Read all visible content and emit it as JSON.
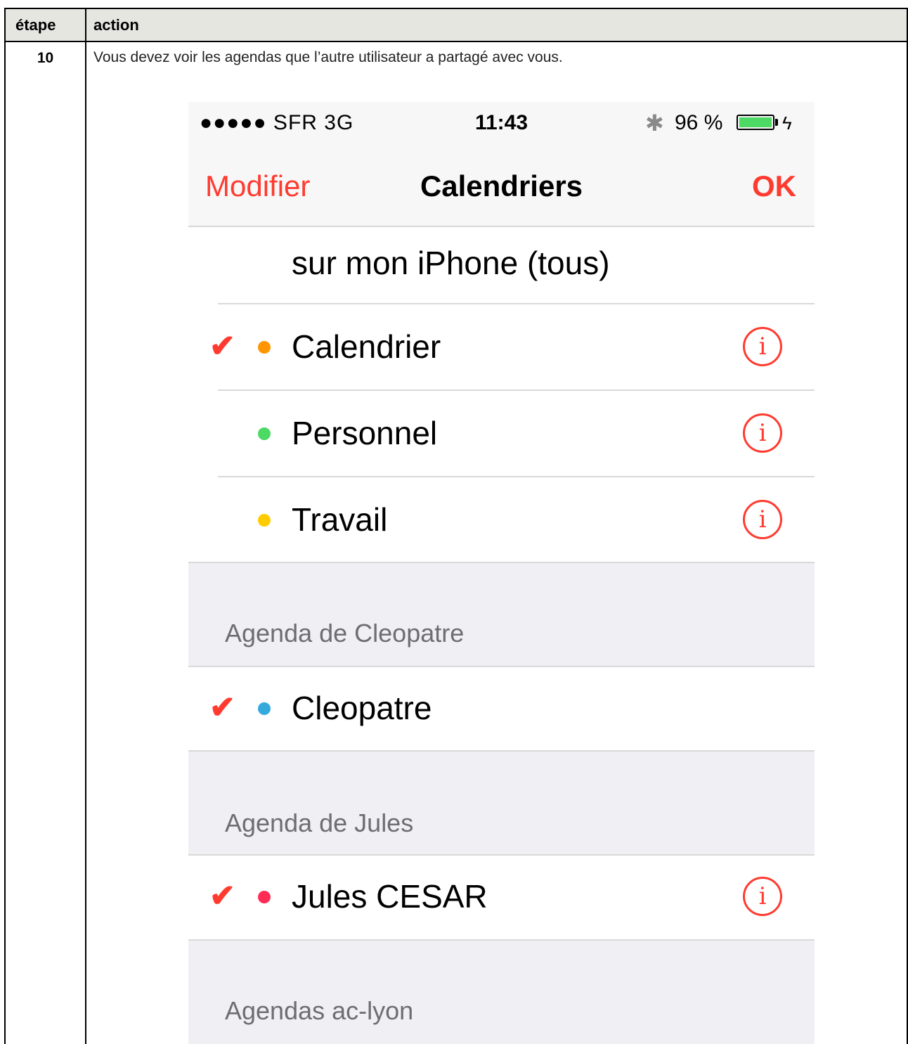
{
  "table": {
    "headers": {
      "step": "étape",
      "action": "action"
    },
    "step_number": "10",
    "action_text": "Vous devez voir les agendas que l’autre utilisateur a partagé avec vous."
  },
  "phone": {
    "status_bar": {
      "carrier": "●●●●● SFR 3G",
      "time": "11:43",
      "battery_percent": "96 %",
      "bluetooth_glyph": "✱",
      "charging_glyph": "ϟ"
    },
    "nav": {
      "edit_label": "Modifier",
      "title": "Calendriers",
      "done_label": "OK"
    },
    "group_all_label": "sur mon iPhone (tous)",
    "calendars": [
      {
        "label": "Calendrier",
        "checked": "✔",
        "color": "#ff9500",
        "info": "i"
      },
      {
        "label": "Personnel",
        "checked": "",
        "color": "#4cd964",
        "info": "i"
      },
      {
        "label": "Travail",
        "checked": "",
        "color": "#ffcc00",
        "info": "i"
      }
    ],
    "sections": [
      {
        "header": "Agenda de Cleopatre",
        "item": {
          "label": "Cleopatre",
          "checked": "✔",
          "color": "#34aadc"
        }
      },
      {
        "header": "Agenda de Jules",
        "item": {
          "label": "Jules CESAR",
          "checked": "✔",
          "color": "#ff2d55",
          "info": "i"
        }
      },
      {
        "header": "Agendas ac-lyon"
      }
    ]
  }
}
